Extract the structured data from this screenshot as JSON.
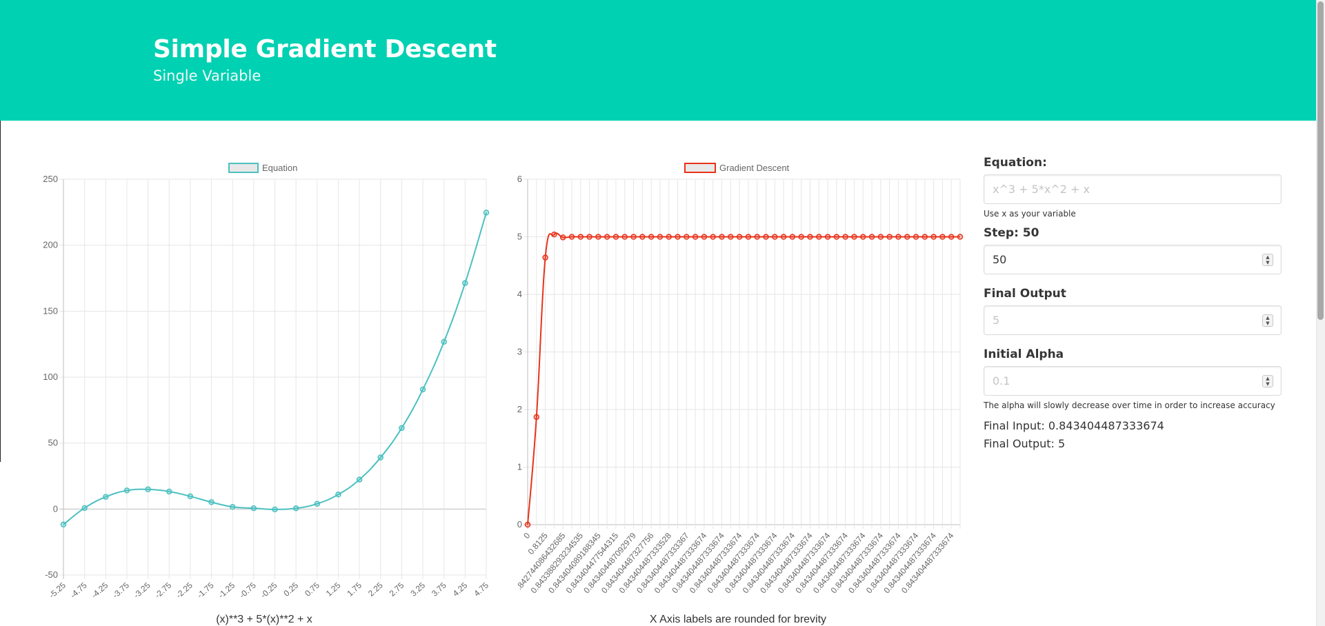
{
  "header": {
    "title": "Simple Gradient Descent",
    "subtitle": "Single Variable"
  },
  "equation_chart": {
    "caption": "(x)**3 + 5*(x)**2 + x"
  },
  "descent_chart": {
    "caption": "X Axis labels are rounded for brevity"
  },
  "form": {
    "equation_label": "Equation:",
    "equation_placeholder": "x^3 + 5*x^2 + x",
    "equation_help": "Use x as your variable",
    "step_label": "Step: 50",
    "step_value": "50",
    "final_output_label": "Final Output",
    "final_output_placeholder": "5",
    "initial_alpha_label": "Initial Alpha",
    "initial_alpha_placeholder": "0.1",
    "alpha_help": "The alpha will slowly decrease over time in order to increase accuracy",
    "final_input_text": "Final Input: 0.843404487333674",
    "final_output_text": "Final Output: 5"
  },
  "colors": {
    "accent": "#00d1b2",
    "equation_line": "#4bc0c0",
    "descent_line": "#e8321a"
  },
  "chart_data": [
    {
      "type": "line",
      "legend_position": "top",
      "grid": true,
      "series": [
        {
          "name": "Equation",
          "x": [
            -5.25,
            -4.75,
            -4.25,
            -3.75,
            -3.25,
            -2.75,
            -2.25,
            -1.75,
            -1.25,
            -0.75,
            -0.25,
            0.25,
            0.75,
            1.25,
            1.75,
            2.25,
            2.75,
            3.25,
            3.75,
            4.25,
            4.75
          ],
          "values": [
            -11.72,
            0.78,
            9.2,
            14.06,
            14.91,
            13.27,
            9.63,
            5.2,
            1.61,
            0.63,
            -0.27,
            0.58,
            3.98,
            11.01,
            22.34,
            39.08,
            61.42,
            90.64,
            126.8,
            171.3,
            224.7
          ]
        }
      ],
      "categories": [
        "-5.25",
        "-4.75",
        "-4.25",
        "-3.75",
        "-3.25",
        "-2.75",
        "-2.25",
        "-1.75",
        "-1.25",
        "-0.75",
        "-0.25",
        "0.25",
        "0.75",
        "1.25",
        "1.75",
        "2.25",
        "2.75",
        "3.25",
        "3.75",
        "4.25",
        "4.75"
      ],
      "y_ticks": [
        -50,
        0,
        50,
        100,
        150,
        200,
        250
      ],
      "ylim": [
        -50,
        250
      ]
    },
    {
      "type": "line",
      "legend_position": "top",
      "grid": true,
      "series": [
        {
          "name": "Gradient Descent",
          "values": [
            0,
            1.87,
            4.64,
            5.04,
            4.99,
            5,
            5,
            5,
            5,
            5,
            5,
            5,
            5,
            5,
            5,
            5,
            5,
            5,
            5,
            5,
            5,
            5,
            5,
            5,
            5,
            5,
            5,
            5,
            5,
            5,
            5,
            5,
            5,
            5,
            5,
            5,
            5,
            5,
            5,
            5,
            5,
            5,
            5,
            5,
            5,
            5,
            5,
            5,
            5,
            5
          ]
        }
      ],
      "categories": [
        "0",
        "0.8125",
        ".842744086432685",
        "0.843388293234535",
        "0.843404089188345",
        "0.843404477544315",
        "0.843404487092979",
        "0.843404487327756",
        "0.843404487333528",
        "0.843404487333367",
        "0.843404487333674",
        "0.843404487333674",
        "0.843404487333674",
        "0.843404487333674",
        "0.843404487333674",
        "0.843404487333674",
        "0.843404487333674",
        "0.843404487333674",
        "0.843404487333674",
        "0.843404487333674",
        "0.843404487333674",
        "0.843404487333674",
        "0.843404487333674",
        "0.843404487333674",
        "0.843404487333674"
      ],
      "y_ticks": [
        0,
        1,
        2,
        3,
        4,
        5,
        6
      ],
      "ylim": [
        0,
        6
      ]
    }
  ]
}
